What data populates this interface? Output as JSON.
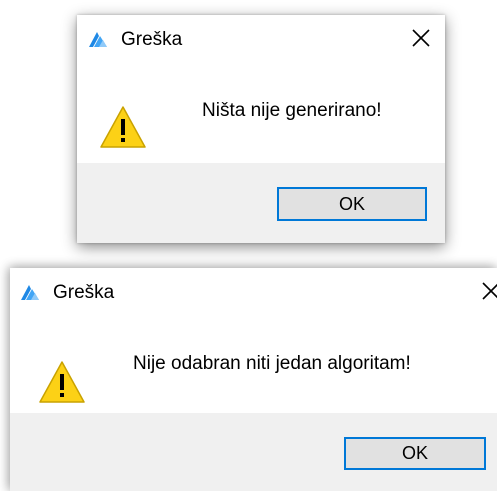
{
  "dialogs": [
    {
      "title": "Greška",
      "message": "Ništa nije generirano!",
      "ok_label": "OK",
      "icon": "warning-icon",
      "close_icon": "close-icon"
    },
    {
      "title": "Greška",
      "message": "Nije odabran niti jedan algoritam!",
      "ok_label": "OK",
      "icon": "warning-icon",
      "close_icon": "close-icon"
    }
  ],
  "colors": {
    "accent": "#0078d7",
    "footer_bg": "#f0f0f0",
    "button_bg": "#e1e1e1",
    "warning_fill": "#fcd116"
  }
}
